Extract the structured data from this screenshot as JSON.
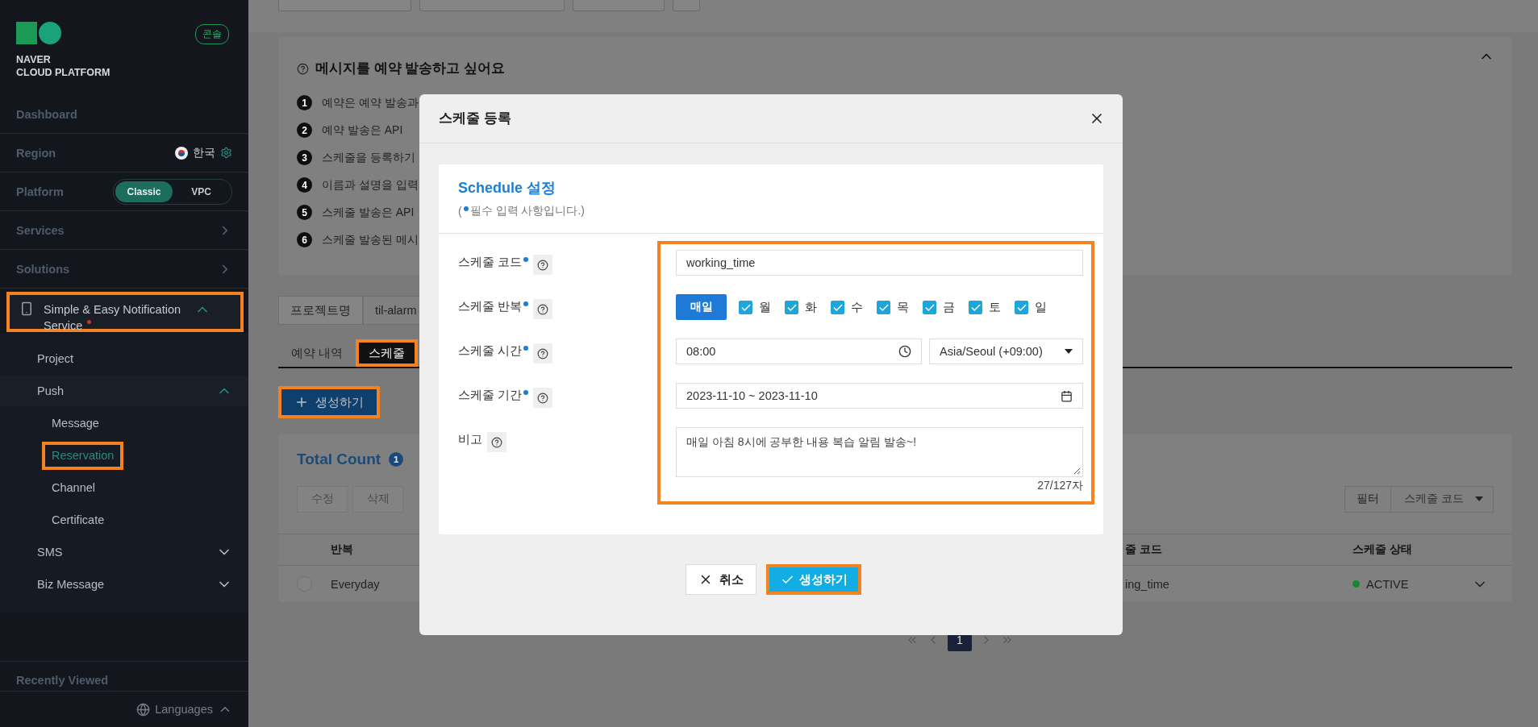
{
  "sidebar": {
    "logo": {
      "line_1": "NAVER",
      "line_2": "CLOUD PLATFORM"
    },
    "console_badge": "콘솔",
    "nav": [
      {
        "kind": "link",
        "label": "Dashboard"
      },
      {
        "kind": "region",
        "label": "Region",
        "value": "한국"
      },
      {
        "kind": "platform",
        "label": "Platform",
        "options": [
          {
            "label": "Classic",
            "selected": true
          },
          {
            "label": "VPC",
            "selected": false
          }
        ]
      },
      {
        "kind": "menu",
        "label": "Services"
      },
      {
        "kind": "menu",
        "label": "Solutions"
      },
      {
        "kind": "service",
        "label": "Simple & Easy Notification Service",
        "expanded": true,
        "highlighted": true,
        "new": true,
        "children": [
          {
            "label": "Project",
            "selected": false,
            "highlighted": false
          },
          {
            "label": "Push",
            "selected": false,
            "highlighted": false,
            "expanded": true,
            "children": [
              {
                "label": "Message",
                "selected": false,
                "highlighted": false
              },
              {
                "label": "Reservation",
                "selected": true,
                "highlighted": true
              },
              {
                "label": "Channel",
                "selected": false,
                "highlighted": false
              },
              {
                "label": "Certificate",
                "selected": false,
                "highlighted": false
              }
            ]
          },
          {
            "label": "SMS",
            "selected": false,
            "highlighted": false,
            "expanded": false
          },
          {
            "label": "Biz Message",
            "selected": false,
            "highlighted": false,
            "expanded": false
          }
        ]
      }
    ],
    "recently_viewed": "Recently Viewed",
    "languages": "Languages"
  },
  "guide": {
    "title": "메시지를 예약 발송하고 싶어요",
    "expanded": true,
    "steps": [
      {
        "number": "1",
        "text": "예약은 예약 발송과"
      },
      {
        "number": "2",
        "text": "예약 발송은 API"
      },
      {
        "number": "3",
        "text": "스케줄을 등록하기"
      },
      {
        "number": "4",
        "text": "이름과 설명을 입력"
      },
      {
        "number": "5",
        "text": "스케줄 발송은 API"
      },
      {
        "number": "6",
        "text": "스케줄 발송된 메시"
      }
    ]
  },
  "project": {
    "label": "프로젝트명",
    "value": "til-alarm"
  },
  "tabs": [
    {
      "label": "예약 내역",
      "selected": false,
      "highlighted": false
    },
    {
      "label": "스케줄",
      "selected": true,
      "highlighted": true
    }
  ],
  "create_button": {
    "label": "생성하기",
    "highlighted": true
  },
  "results": {
    "title": "Total Count",
    "count": "1",
    "actions": [
      {
        "label": "수정",
        "disabled": true
      },
      {
        "label": "삭제",
        "disabled": true
      }
    ],
    "filter": {
      "label": "필터",
      "value": "스케줄 코드"
    },
    "columns": [
      "반복",
      "줄 코드",
      "스케줄 상태"
    ],
    "rows": [
      {
        "selected": false,
        "cells": [
          "Everyday",
          "ing_time"
        ],
        "status": {
          "label": "ACTIVE",
          "color": "#12892f"
        }
      }
    ]
  },
  "pagination": {
    "current": "1"
  },
  "modal": {
    "title": "스케줄 등록",
    "section_title": "Schedule 설정",
    "required_note": {
      "prefix": "(",
      "text": "필수 입력 사항입니다.)"
    },
    "form": {
      "highlighted": true,
      "fields": [
        {
          "kind": "text",
          "label": "스케줄 코드",
          "required": true,
          "value": "working_time"
        },
        {
          "kind": "repeat",
          "label": "스케줄 반복",
          "required": true,
          "button": "매일",
          "days": [
            {
              "label": "월",
              "checked": true
            },
            {
              "label": "화",
              "checked": true
            },
            {
              "label": "수",
              "checked": true
            },
            {
              "label": "목",
              "checked": true
            },
            {
              "label": "금",
              "checked": true
            },
            {
              "label": "토",
              "checked": true
            },
            {
              "label": "일",
              "checked": true
            }
          ]
        },
        {
          "kind": "time",
          "label": "스케줄 시간",
          "required": true,
          "value": "08:00",
          "timezone": "Asia/Seoul (+09:00)"
        },
        {
          "kind": "daterange",
          "label": "스케줄 기간",
          "required": true,
          "value": "2023-11-10 ~ 2023-11-10"
        },
        {
          "kind": "textarea",
          "label": "비고",
          "value": "매일 아침 8시에 공부한 내용 복습 알림 발송~!",
          "counter": "27/127자"
        }
      ]
    },
    "cancel": "취소",
    "submit": {
      "label": "생성하기",
      "highlighted": true
    }
  }
}
